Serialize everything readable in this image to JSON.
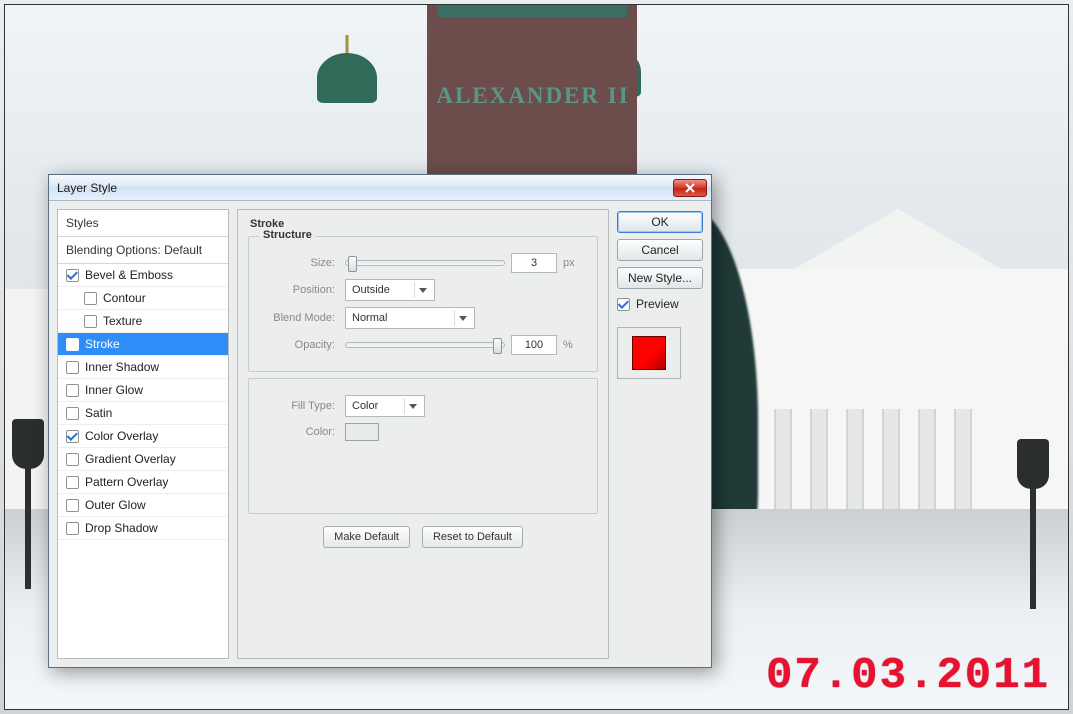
{
  "photo": {
    "inscription": "ALEXANDER II",
    "datestamp": "07.03.2011"
  },
  "dialog": {
    "title": "Layer Style",
    "effects_header": "Styles",
    "blending_header": "Blending Options: Default",
    "effects": [
      {
        "key": "bevel",
        "label": "Bevel & Emboss",
        "checked": true,
        "sub": false
      },
      {
        "key": "contour",
        "label": "Contour",
        "checked": false,
        "sub": true
      },
      {
        "key": "texture",
        "label": "Texture",
        "checked": false,
        "sub": true
      },
      {
        "key": "stroke",
        "label": "Stroke",
        "checked": false,
        "sub": false,
        "selected": true
      },
      {
        "key": "innershadow",
        "label": "Inner Shadow",
        "checked": false,
        "sub": false
      },
      {
        "key": "innerglow",
        "label": "Inner Glow",
        "checked": false,
        "sub": false
      },
      {
        "key": "satin",
        "label": "Satin",
        "checked": false,
        "sub": false
      },
      {
        "key": "coloroverlay",
        "label": "Color Overlay",
        "checked": true,
        "sub": false
      },
      {
        "key": "gradientoverlay",
        "label": "Gradient Overlay",
        "checked": false,
        "sub": false
      },
      {
        "key": "patternoverlay",
        "label": "Pattern Overlay",
        "checked": false,
        "sub": false
      },
      {
        "key": "outerglow",
        "label": "Outer Glow",
        "checked": false,
        "sub": false
      },
      {
        "key": "dropshadow",
        "label": "Drop Shadow",
        "checked": false,
        "sub": false
      }
    ],
    "panel": {
      "title": "Stroke",
      "structure_legend": "Structure",
      "size_label": "Size:",
      "size_value": "3",
      "size_unit": "px",
      "position_label": "Position:",
      "position_value": "Outside",
      "blendmode_label": "Blend Mode:",
      "blendmode_value": "Normal",
      "opacity_label": "Opacity:",
      "opacity_value": "100",
      "opacity_unit": "%",
      "filltype_label": "Fill Type:",
      "filltype_value": "Color",
      "color_label": "Color:",
      "make_default": "Make Default",
      "reset_default": "Reset to Default"
    },
    "buttons": {
      "ok": "OK",
      "cancel": "Cancel",
      "newstyle": "New Style...",
      "preview": "Preview"
    },
    "swatch_color": "#ff0000"
  }
}
